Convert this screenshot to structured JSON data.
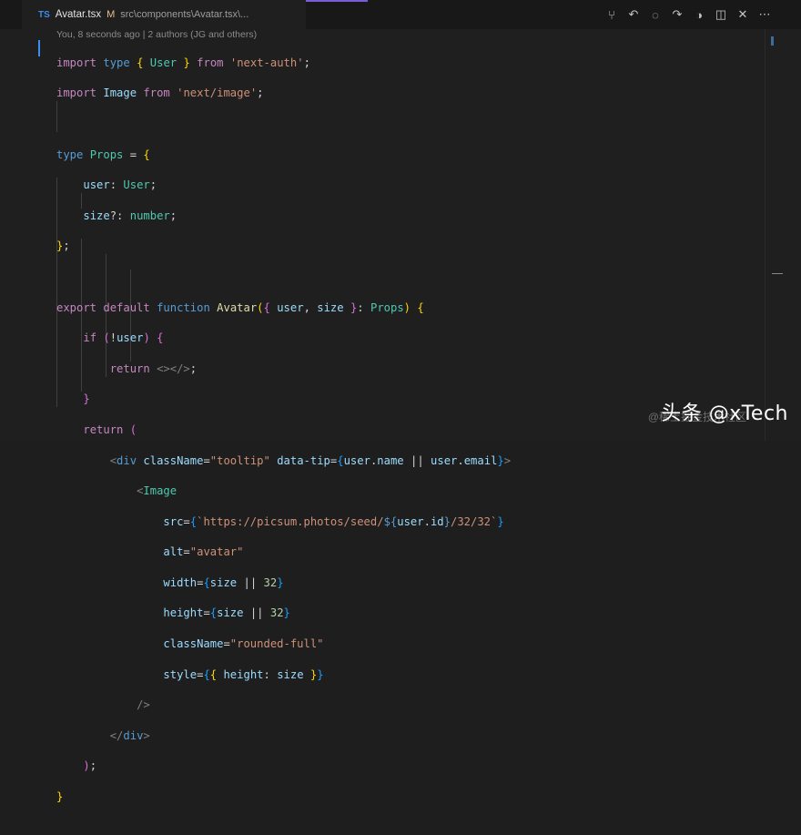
{
  "tab": {
    "lang": "TS",
    "filename": "Avatar.tsx",
    "modified": "M",
    "path": "src\\components\\Avatar.tsx\\..."
  },
  "codelens": "You, 8 seconds ago | 2 authors (JG and others)",
  "watermark": "头条 @xTech",
  "watermark_sub": "@稀土掘金技术社区",
  "icons": [
    "source-control-icon",
    "go-back-icon",
    "circle-icon",
    "go-forward-icon",
    "toggle-icon",
    "split-editor-icon",
    "close-icon",
    "more-icon"
  ]
}
